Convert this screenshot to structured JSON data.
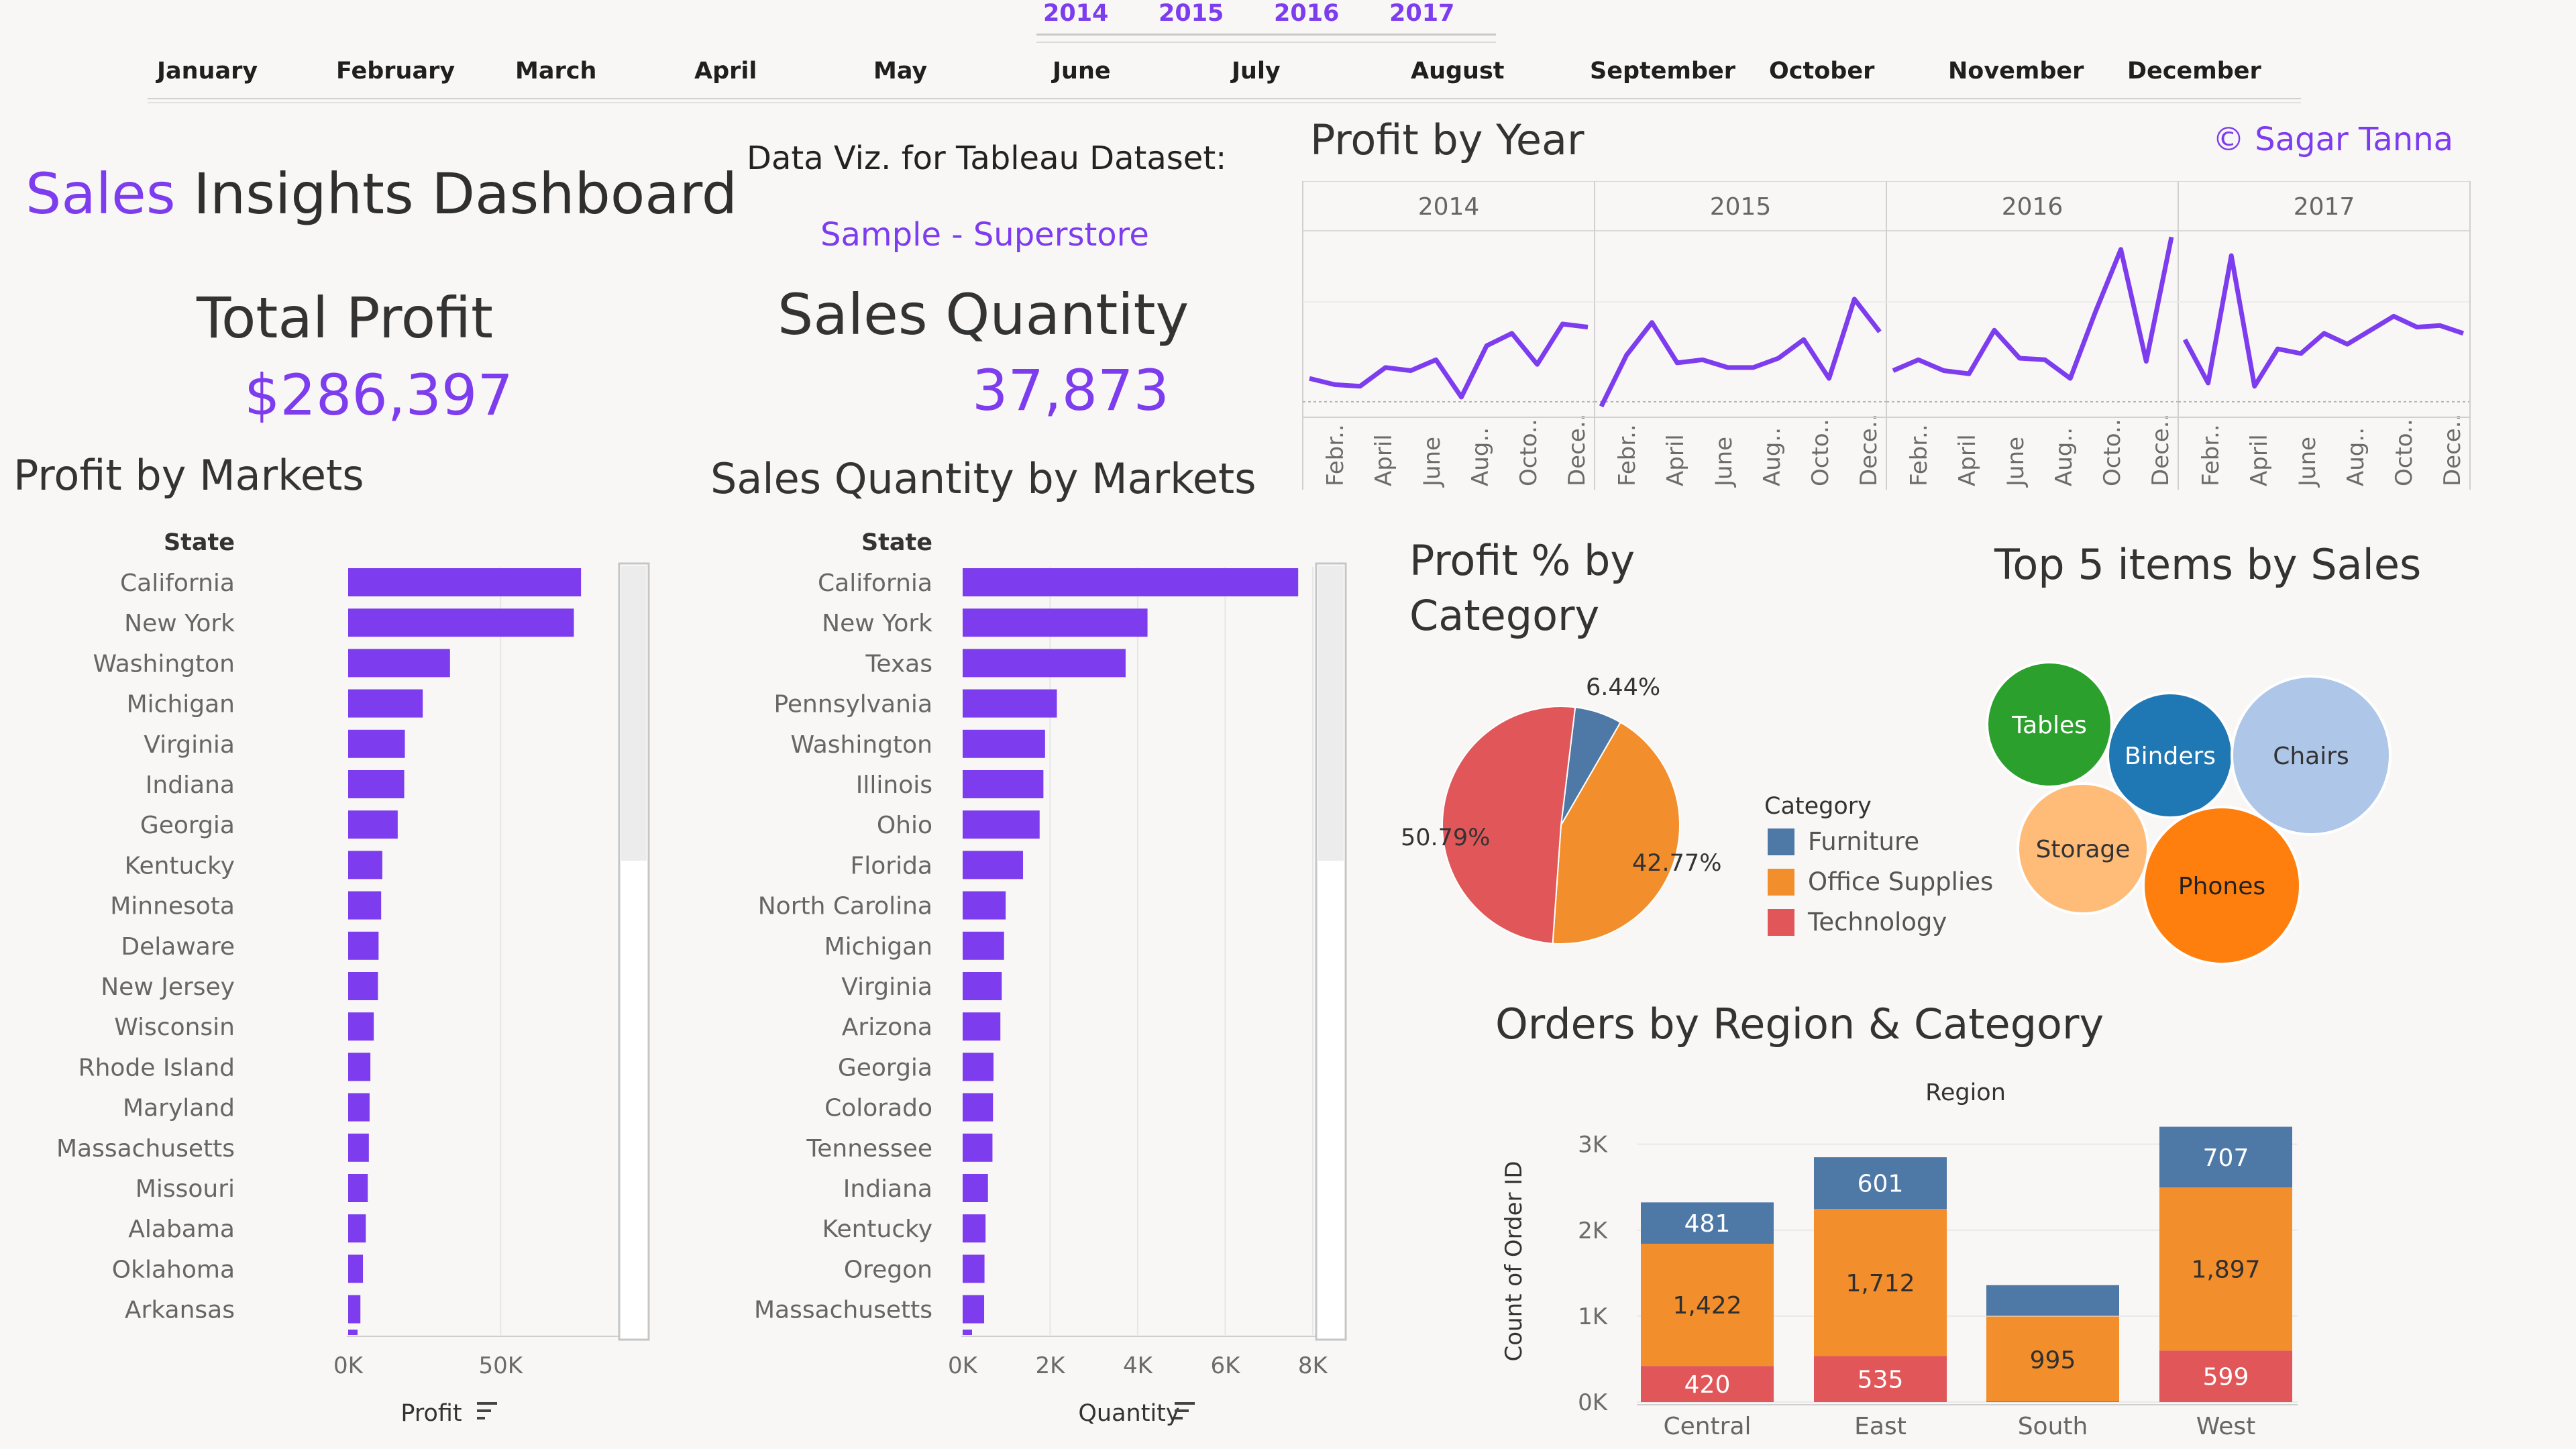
{
  "filters": {
    "years": [
      "2014",
      "2015",
      "2016",
      "2017"
    ],
    "months": [
      "January",
      "February",
      "March",
      "April",
      "May",
      "June",
      "July",
      "August",
      "September",
      "October",
      "November",
      "December"
    ]
  },
  "header": {
    "title_accent": "Sales",
    "title_rest": "Insights Dashboard",
    "dataviz_label": "Data Viz. for Tableau Dataset:",
    "dataset_name": "Sample - Superstore",
    "copyright": "© Sagar Tanna"
  },
  "kpis": {
    "profit_label": "Total Profit",
    "profit_value": "$286,397",
    "quantity_label": "Sales Quantity",
    "quantity_value": "37,873"
  },
  "colors": {
    "accent": "#7d3cee",
    "furniture": "#4e79a7",
    "office_supplies": "#f28e2b",
    "technology": "#e15759",
    "tables": "#2ca02c",
    "binders": "#1f77b4",
    "chairs": "#aec7e8",
    "storage": "#ffbb78",
    "phones": "#ff7f0e"
  },
  "chart_data": [
    {
      "id": "profit_by_year",
      "type": "line",
      "title": "Profit by Year",
      "panels": [
        "2014",
        "2015",
        "2016",
        "2017"
      ],
      "x_tick_labels": [
        "Febr..",
        "April",
        "June",
        "Aug..",
        "Octo..",
        "Dece.."
      ],
      "series": [
        {
          "values": [
            1500,
            1100,
            1000,
            2200,
            2000,
            2700,
            300,
            3600,
            4400,
            2400,
            5000,
            4800
          ]
        },
        {
          "values": [
            -300,
            3000,
            5100,
            2500,
            2700,
            2200,
            2200,
            2800,
            4000,
            1500,
            6600,
            4500
          ]
        },
        {
          "values": [
            2000,
            2700,
            2000,
            1800,
            4600,
            2800,
            2700,
            1500,
            5800,
            9800,
            2600,
            10600
          ]
        },
        {
          "values": [
            4000,
            1200,
            9400,
            1000,
            3400,
            3100,
            4400,
            3700,
            4600,
            5500,
            4800,
            4900,
            4400
          ]
        }
      ]
    },
    {
      "id": "profit_by_markets",
      "type": "bar",
      "title": "Profit by Markets",
      "ylabel": "State",
      "xlabel": "Profit",
      "x_ticks": [
        "0K",
        "50K"
      ],
      "xlim": [
        0,
        90000
      ],
      "categories": [
        "California",
        "New York",
        "Washington",
        "Michigan",
        "Virginia",
        "Indiana",
        "Georgia",
        "Kentucky",
        "Minnesota",
        "Delaware",
        "New Jersey",
        "Wisconsin",
        "Rhode Island",
        "Maryland",
        "Massachusetts",
        "Missouri",
        "Alabama",
        "Oklahoma",
        "Arkansas"
      ],
      "values": [
        76381,
        74039,
        33403,
        24463,
        18598,
        18383,
        16250,
        11200,
        10823,
        9977,
        9773,
        8402,
        7286,
        7031,
        6786,
        6436,
        5787,
        4853,
        4008
      ]
    },
    {
      "id": "sales_quantity_by_markets",
      "type": "bar",
      "title": "Sales Quantity by Markets",
      "ylabel": "State",
      "xlabel": "Quantity",
      "x_ticks": [
        "0K",
        "2K",
        "4K",
        "6K",
        "8K"
      ],
      "xlim": [
        0,
        8400
      ],
      "categories": [
        "California",
        "New York",
        "Texas",
        "Pennsylvania",
        "Washington",
        "Illinois",
        "Ohio",
        "Florida",
        "North Carolina",
        "Michigan",
        "Virginia",
        "Arizona",
        "Georgia",
        "Colorado",
        "Tennessee",
        "Indiana",
        "Kentucky",
        "Oregon",
        "Massachusetts"
      ],
      "values": [
        7667,
        4224,
        3724,
        2153,
        1883,
        1845,
        1759,
        1379,
        983,
        946,
        893,
        862,
        705,
        693,
        681,
        578,
        523,
        499,
        491
      ]
    },
    {
      "id": "profit_pct_by_category",
      "type": "pie",
      "title": "Profit % by Category",
      "legend_title": "Category",
      "categories": [
        "Furniture",
        "Office Supplies",
        "Technology"
      ],
      "values": [
        6.44,
        42.77,
        50.79
      ],
      "labels": [
        "6.44%",
        "42.77%",
        "50.79%"
      ]
    },
    {
      "id": "top5_items_by_sales",
      "type": "bubble",
      "title": "Top 5 items by Sales",
      "categories": [
        "Tables",
        "Binders",
        "Chairs",
        "Storage",
        "Phones"
      ]
    },
    {
      "id": "orders_by_region_category",
      "type": "bar",
      "title": "Orders by Region & Category",
      "xlabel": "Region",
      "ylabel": "Count of Order ID",
      "y_ticks": [
        "0K",
        "1K",
        "2K",
        "3K"
      ],
      "ylim": [
        0,
        3200
      ],
      "categories": [
        "Central",
        "East",
        "South",
        "West"
      ],
      "series": [
        {
          "name": "Technology",
          "values": [
            420,
            535,
            0,
            599
          ]
        },
        {
          "name": "Office Supplies",
          "values": [
            1422,
            1712,
            995,
            1897
          ]
        },
        {
          "name": "Furniture",
          "values": [
            481,
            601,
            0,
            707
          ]
        }
      ],
      "value_labels": {
        "Technology": [
          "420",
          "535",
          "",
          "599"
        ],
        "Office Supplies": [
          "1,422",
          "1,712",
          "995",
          "1,897"
        ],
        "Furniture": [
          "481",
          "601",
          "",
          "707"
        ]
      }
    }
  ]
}
